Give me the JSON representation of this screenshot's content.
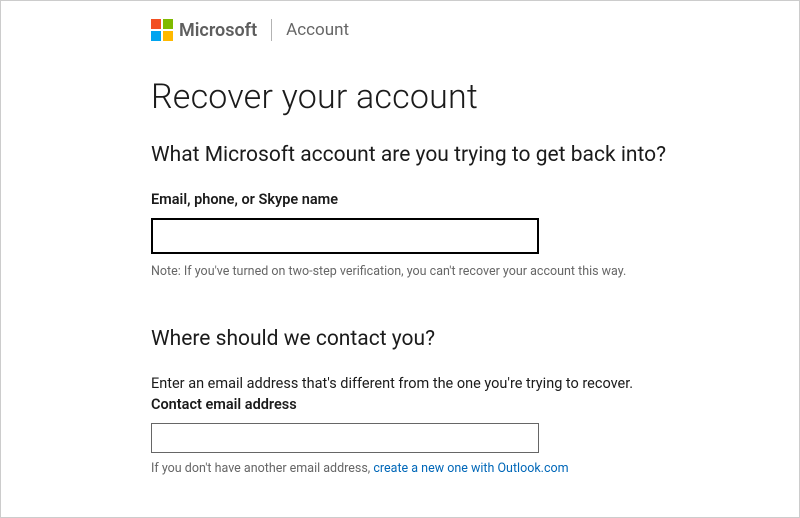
{
  "header": {
    "brand": "Microsoft",
    "section": "Account"
  },
  "page": {
    "title": "Recover your account"
  },
  "account_section": {
    "heading": "What Microsoft account are you trying to get back into?",
    "field_label": "Email, phone, or Skype name",
    "input_value": "",
    "note": "Note: If you've turned on two-step verification, you can't recover your account this way."
  },
  "contact_section": {
    "heading": "Where should we contact you?",
    "instruction": "Enter an email address that's different from the one you're trying to recover.",
    "field_label": "Contact email address",
    "input_value": "",
    "link_prefix": "If you don't have another email address, ",
    "link_text": "create a new one with Outlook.com"
  }
}
